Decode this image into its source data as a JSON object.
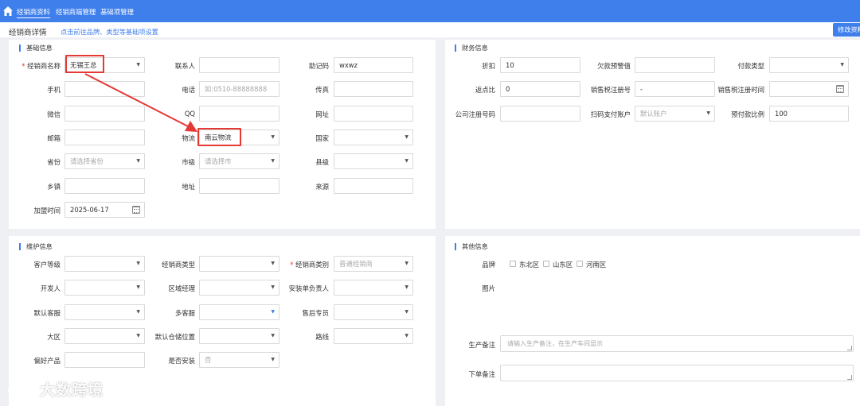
{
  "topbar": {
    "tabs": [
      "经销商资料",
      "经销商端管理",
      "基础项管理"
    ]
  },
  "subbar": {
    "title": "经销商详情",
    "hint": "点击前往品牌、类型等基础项设置",
    "edit_button": "修改资料"
  },
  "basic": {
    "title": "基础信息",
    "dealer_name_label": "经销商名称",
    "dealer_name_value": "无锡王总",
    "contact_label": "联系人",
    "mnemonic_label": "助记码",
    "mnemonic_value": "wxwz",
    "mobile_label": "手机",
    "phone_label": "电话",
    "phone_placeholder": "如:0510-88888888",
    "fax_label": "传真",
    "wechat_label": "微信",
    "qq_label": "QQ",
    "website_label": "网址",
    "email_label": "邮箱",
    "logistics_label": "物流",
    "logistics_value": "南云物流",
    "country_label": "国家",
    "province_label": "省份",
    "province_placeholder": "请选择省份",
    "city_label": "市级",
    "city_placeholder": "请选择市",
    "county_label": "县级",
    "town_label": "乡镇",
    "address_label": "地址",
    "source_label": "来源",
    "join_time_label": "加盟时间",
    "join_time_value": "2025-06-17"
  },
  "finance": {
    "title": "财务信息",
    "discount_label": "折扣",
    "discount_value": "10",
    "debt_warning_label": "欠款预警值",
    "payment_type_label": "付款类型",
    "rebate_label": "返点比",
    "rebate_value": "0",
    "tax_reg_label": "销售税注册号",
    "tax_reg_value": "-",
    "tax_reg_time_label": "销售税注册时间",
    "company_reg_label": "公司注册号码",
    "scan_account_label": "扫码支付账户",
    "scan_account_value": "默认账户",
    "prepay_ratio_label": "预付款比例",
    "prepay_ratio_value": "100"
  },
  "maintenance": {
    "title": "维护信息",
    "customer_level_label": "客户等级",
    "dealer_type_label": "经销商类型",
    "dealer_category_label": "经销商类别",
    "dealer_category_value": "普通经销商",
    "developer_label": "开发人",
    "region_manager_label": "区域经理",
    "install_owner_label": "安装单负责人",
    "default_service_label": "默认客服",
    "multi_service_label": "多客服",
    "aftersales_label": "售后专员",
    "big_region_label": "大区",
    "default_warehouse_label": "默认仓储位置",
    "route_label": "路线",
    "preferred_product_label": "偏好产品",
    "install_label": "是否安装",
    "install_value": "否"
  },
  "other": {
    "title": "其他信息",
    "brand_label": "品牌",
    "brands": [
      "东北区",
      "山东区",
      "河南区"
    ],
    "image_label": "图片",
    "production_note_label": "生产备注",
    "production_note_placeholder": "请输入生产备注，在生产车间显示",
    "order_note_label": "下单备注"
  },
  "watermark": "大数跨境",
  "colors": {
    "accent": "#3f7fec",
    "highlight": "#e53935"
  }
}
